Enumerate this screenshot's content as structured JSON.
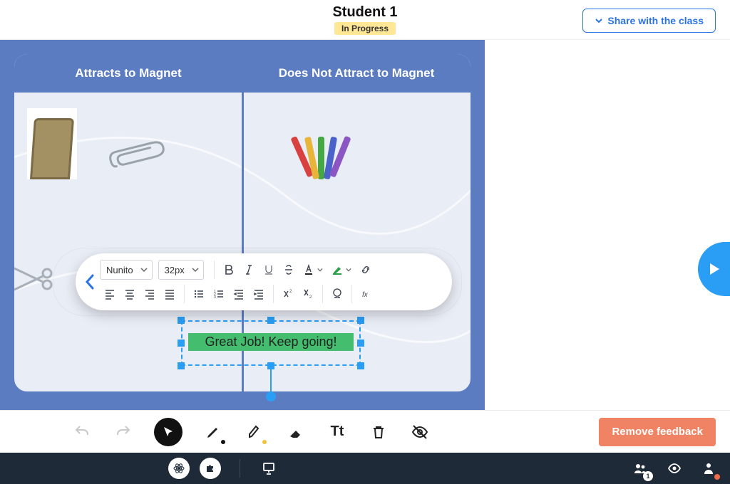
{
  "header": {
    "student_name": "Student 1",
    "status": "In Progress",
    "share_label": "Share with the class"
  },
  "activity": {
    "left_header": "Attracts to Magnet",
    "right_header": "Does Not Attract to Magnet",
    "items_left": [
      "folding-chair",
      "paper-clip",
      "scissors"
    ],
    "items_right": [
      "crayons"
    ]
  },
  "text_box": {
    "content": "Great Job! Keep going!",
    "highlight_color": "#44bd6e"
  },
  "text_toolbar": {
    "font_family": "Nunito",
    "font_size": "32px",
    "row1": [
      "bold",
      "italic",
      "underline",
      "strike",
      "text-color",
      "highlight",
      "link"
    ],
    "row2": [
      "align-left",
      "align-center",
      "align-right",
      "align-justify",
      "bullets",
      "numbered",
      "indent-dec",
      "indent-inc",
      "superscript",
      "subscript",
      "omega",
      "fx"
    ]
  },
  "toolstrip": {
    "tools": [
      "undo",
      "redo",
      "cursor",
      "pen",
      "highlighter",
      "eraser",
      "text",
      "trash",
      "visibility-off"
    ],
    "remove_label": "Remove feedback"
  },
  "bottombar": {
    "left_icons": [
      "atom",
      "puzzle",
      "presentation"
    ],
    "right_icons": [
      "group",
      "eye",
      "person"
    ],
    "group_count": 1
  },
  "colors": {
    "frame": "#5c7cc1",
    "accent_blue": "#2a9df4",
    "accent_green": "#44bd6e",
    "remove_btn": "#ef8363"
  }
}
